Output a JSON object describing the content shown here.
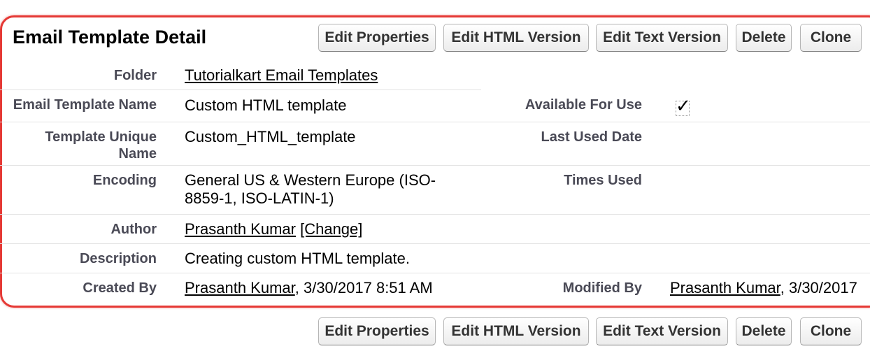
{
  "header": {
    "title": "Email Template Detail"
  },
  "buttons": {
    "edit_properties": "Edit Properties",
    "edit_html": "Edit HTML Version",
    "edit_text": "Edit Text Version",
    "delete": "Delete",
    "clone": "Clone"
  },
  "fields": {
    "folder_label": "Folder",
    "folder_value": "Tutorialkart Email Templates",
    "name_label": "Email Template Name",
    "name_value": "Custom HTML template",
    "available_label": "Available For Use",
    "available_check": "✓",
    "unique_label_line1": "Template Unique",
    "unique_label_line2": "Name",
    "unique_value": "Custom_HTML_template",
    "last_used_label": "Last Used Date",
    "encoding_label": "Encoding",
    "encoding_value_line1": "General US & Western Europe (ISO-",
    "encoding_value_line2": "8859-1, ISO-LATIN-1)",
    "times_used_label": "Times Used",
    "author_label": "Author",
    "author_value": "Prasanth Kumar",
    "author_change": "[Change]",
    "description_label": "Description",
    "description_value": "Creating custom HTML template.",
    "created_label": "Created By",
    "created_user": "Prasanth Kumar",
    "created_date": ", 3/30/2017 8:51 AM",
    "modified_label": "Modified By",
    "modified_user": "Prasanth Kumar",
    "modified_date": ", 3/30/2017"
  },
  "colors": {
    "highlight_border": "#e53935",
    "label_text": "#4a4a56"
  }
}
